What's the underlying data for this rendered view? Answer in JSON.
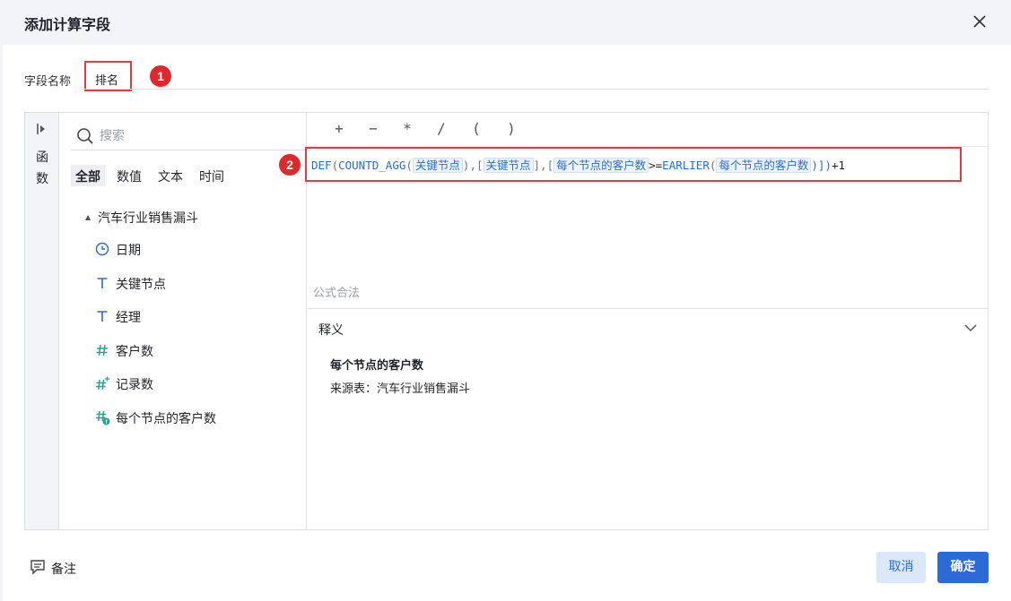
{
  "dialog": {
    "title": "添加计算字段",
    "close_icon": "close-icon"
  },
  "field": {
    "label": "字段名称",
    "value": "排名"
  },
  "badges": [
    "1",
    "2"
  ],
  "functions_panel": {
    "label_line1": "函",
    "label_line2": "数",
    "icon": "collapse-panel-icon"
  },
  "search": {
    "placeholder": "搜索",
    "icon": "search-icon"
  },
  "filter_tabs": [
    {
      "label": "全部",
      "active": true
    },
    {
      "label": "数值",
      "active": false
    },
    {
      "label": "文本",
      "active": false
    },
    {
      "label": "时间",
      "active": false
    }
  ],
  "tree": {
    "root": "汽车行业销售漏斗",
    "items": [
      {
        "label": "日期",
        "icon": "clock-icon"
      },
      {
        "label": "关键节点",
        "icon": "text-type-icon"
      },
      {
        "label": "经理",
        "icon": "text-type-icon"
      },
      {
        "label": "客户数",
        "icon": "number-type-icon"
      },
      {
        "label": "记录数",
        "icon": "number-plus-icon"
      },
      {
        "label": "每个节点的客户数",
        "icon": "calculated-number-icon"
      }
    ]
  },
  "operators": [
    "+",
    "−",
    "*",
    "/",
    "(",
    ")"
  ],
  "formula": {
    "f1": "DEF",
    "p1": "(",
    "f2": "COUNTD_AGG",
    "p2": "(",
    "t1": "关键节点",
    "p3": "),[",
    "t2": "关键节点",
    "p4": "],[",
    "t3": "每个节点的客户数",
    "op1": ">=",
    "f3": "EARLIER",
    "p5": "(",
    "t4": "每个节点的客户数",
    "p6": ")])",
    "tail": "+1"
  },
  "status": "公式合法",
  "explanation": {
    "title": "释义",
    "name": "每个节点的客户数",
    "source": "来源表：汽车行业销售漏斗"
  },
  "footer": {
    "note_label": "备注",
    "cancel_label": "取消",
    "ok_label": "确定"
  },
  "colors": {
    "accent": "#2a6bd8",
    "highlight_red": "#e23d3d",
    "badge_red": "#e0282c",
    "number_icon": "#2ba28f"
  }
}
